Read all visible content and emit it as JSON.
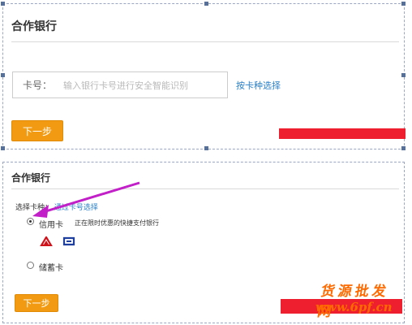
{
  "top_panel": {
    "title": "合作银行",
    "card_label": "卡号：",
    "card_placeholder": "输入银行卡号进行安全智能识别",
    "select_by_type_link": "按卡种选择",
    "next_button": "下一步"
  },
  "bottom_panel": {
    "title": "合作银行",
    "select_type_label": "选择卡种：",
    "select_type_link": "通过卡号选择",
    "credit_card_label": "信用卡",
    "credit_card_promo": "正在限时优惠的快捷支付银行",
    "savings_card_label": "储蓄卡",
    "next_button": "下一步",
    "selected_option": "信用卡"
  },
  "watermark": {
    "text": "货源批发网",
    "url": "www.6pf.cn"
  },
  "colors": {
    "accent_button": "#f29b12",
    "link": "#2a80c9",
    "redaction": "#ee1f2e",
    "arrow": "#c21fc8",
    "watermark": "#ff6a00"
  },
  "icons": [
    "radio-checked-icon",
    "radio-unchecked-icon",
    "bank-logo-red-icon",
    "bank-logo-blue-icon",
    "annotation-arrow-icon"
  ]
}
